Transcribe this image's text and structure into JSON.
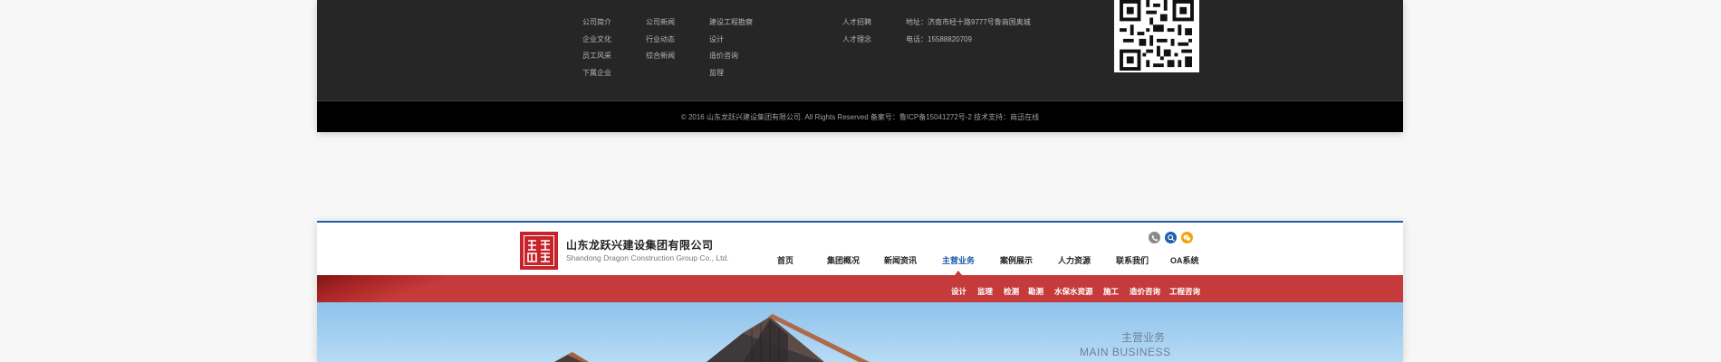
{
  "footer": {
    "columns": [
      [
        "公司简介",
        "企业文化",
        "员工风采",
        "下属企业"
      ],
      [
        "公司新闻",
        "行业动态",
        "综合新闻"
      ],
      [
        "建设工程勘察",
        "设计",
        "造价咨询",
        "监理"
      ],
      [
        "人才招聘",
        "人才理念"
      ],
      [
        "地址：济南市经十路9777号鲁商国奥城",
        "电话：15588820709"
      ]
    ],
    "copyright": "© 2016 山东龙跃兴建设集团有限公司. All Rights Reserved   备案号：鲁ICP备15041272号-2  技术支持：商迅在线"
  },
  "header": {
    "company_name_cn": "山东龙跃兴建设集团有限公司",
    "company_name_en": "Shandong Dragon Construction Group Co., Ltd.",
    "icons": [
      "phone-icon",
      "search-icon",
      "wechat-icon"
    ],
    "nav": [
      "首页",
      "集团概况",
      "新闻资讯",
      "主营业务",
      "案例展示",
      "人力资源",
      "联系我们",
      "OA系统"
    ],
    "active_nav": "主营业务",
    "subnav": [
      "设计",
      "监理",
      "检测",
      "勘测",
      "水保水资源",
      "施工",
      "造价咨询",
      "工程咨询"
    ]
  },
  "hero": {
    "title_cn": "主营业务",
    "title_en": "MAIN BUSINESS"
  },
  "colors": {
    "accent_blue": "#1f5ea8",
    "red_bar": "#c53a3a",
    "footer_bg": "#262626",
    "copyright_bg": "#000000"
  }
}
